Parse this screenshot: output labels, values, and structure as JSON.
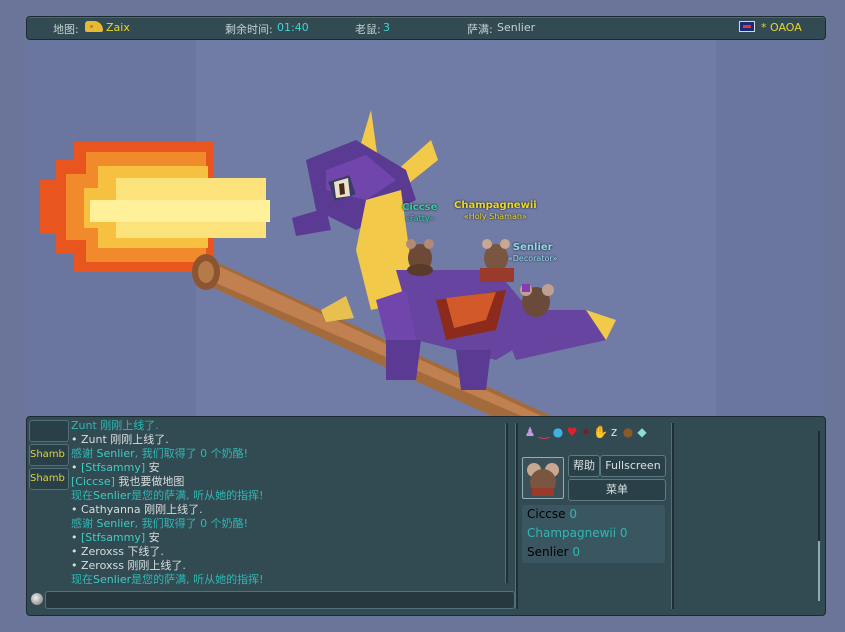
{
  "topbar": {
    "map_label": "地图:",
    "map_value": "Zaix",
    "time_label": "剩余时间:",
    "time_value": "01:40",
    "mice_label": "老鼠:",
    "mice_value": "3",
    "shaman_label": "萨满:",
    "shaman_value": "Senlier",
    "room_value": "* OAOA"
  },
  "scene": {
    "mice": [
      {
        "name": "Ciccse",
        "title": "«Fatty»",
        "color": "#2ed0a0"
      },
      {
        "name": "Champagnewii",
        "title": "«Holy Shaman»",
        "color": "#ecd82a"
      },
      {
        "name": "Senlier",
        "title": "«Decorator»",
        "color": "#8fdcf0"
      }
    ]
  },
  "chat": {
    "tabs": [
      "",
      "Shamb",
      "Shamb"
    ],
    "lines": [
      {
        "style": "sys",
        "segs": [
          "Zunt 刚刚上线了."
        ]
      },
      {
        "style": "white",
        "segs": [
          "• Zunt 刚刚上线了."
        ]
      },
      {
        "style": "teal",
        "segs": [
          "感谢 ",
          "Senlier",
          ", 我们取得了 0 个奶酪!"
        ]
      },
      {
        "style": "white",
        "segs": [
          "• ",
          "[Stfsammy]",
          " 安"
        ]
      },
      {
        "style": "white",
        "segs": [
          "[Ciccse]",
          " 我也要做地图"
        ]
      },
      {
        "style": "teal",
        "segs": [
          "现在",
          "Senlier",
          "是您的萨满, 听从她的指挥!"
        ]
      },
      {
        "style": "white",
        "segs": [
          "• Cathyanna 刚刚上线了."
        ]
      },
      {
        "style": "teal",
        "segs": [
          "感谢 ",
          "Senlier",
          ", 我们取得了 0 个奶酪!"
        ]
      },
      {
        "style": "white",
        "segs": [
          "• ",
          "[Stfsammy]",
          " 安"
        ]
      },
      {
        "style": "white",
        "segs": [
          "• Zeroxss 下线了."
        ]
      },
      {
        "style": "white",
        "segs": [
          "• Zeroxss 刚刚上线了."
        ]
      },
      {
        "style": "teal",
        "segs": [
          "现在",
          "Senlier",
          "是您的萨满, 听从她的指挥!"
        ]
      }
    ]
  },
  "side": {
    "help_label": "帮助",
    "fullscreen_label": "Fullscreen",
    "menu_label": "菜单",
    "players": [
      {
        "name": "Ciccse",
        "score": "0",
        "color": "#d6dede"
      },
      {
        "name": "Champagnewii",
        "score": "0",
        "color": "#2fb8b4"
      },
      {
        "name": "Senlier",
        "score": "0",
        "color": "#d6dede"
      }
    ],
    "icons": [
      "dress-icon",
      "mustache-icon",
      "drop-icon",
      "heart-icon",
      "spider-icon",
      "hand-icon",
      "sleep-icon",
      "moustache-icon",
      "crystal-icon"
    ]
  }
}
